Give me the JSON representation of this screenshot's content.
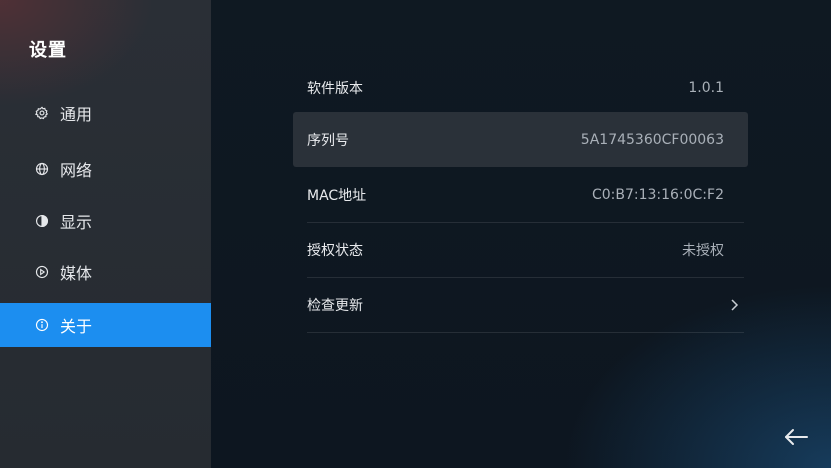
{
  "sidebar": {
    "title": "设置",
    "items": [
      {
        "label": "通用",
        "icon": "gear-icon"
      },
      {
        "label": "网络",
        "icon": "globe-icon"
      },
      {
        "label": "显示",
        "icon": "display-icon"
      },
      {
        "label": "媒体",
        "icon": "play-icon"
      },
      {
        "label": "关于",
        "icon": "info-icon"
      }
    ],
    "active_index": 4
  },
  "about": {
    "rows": [
      {
        "label": "软件版本",
        "value": "1.0.1"
      },
      {
        "label": "序列号",
        "value": "5A1745360CF00063"
      },
      {
        "label": "MAC地址",
        "value": "C0:B7:13:16:0C:F2"
      },
      {
        "label": "授权状态",
        "value": "未授权"
      },
      {
        "label": "检查更新",
        "value": ""
      }
    ]
  },
  "colors": {
    "accent": "#1c8ef0",
    "background": "#0f1922",
    "sidebar": "#2a2f36"
  },
  "icons": {
    "chevron": "chevron-right-icon",
    "back": "back-arrow-icon"
  }
}
